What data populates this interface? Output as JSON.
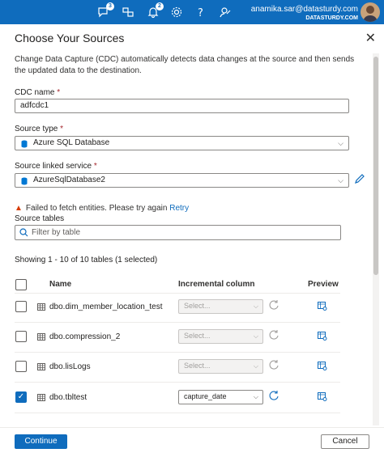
{
  "topbar": {
    "feedback_badge": "3",
    "notifications_badge": "2",
    "user_email": "anamika.sar@datasturdy.com",
    "user_org": "DATASTURDY.COM",
    "accent_color": "#0f6cbd"
  },
  "panel": {
    "title": "Choose Your Sources",
    "close": "✕",
    "description": "Change Data Capture (CDC) automatically detects data changes at the source and then sends the updated data to the destination."
  },
  "form": {
    "cdc_name_label": "CDC name",
    "cdc_name_value": "adfcdc1",
    "source_type_label": "Source type",
    "source_type_value": "Azure SQL Database",
    "linked_service_label": "Source linked service",
    "linked_service_value": "AzureSqlDatabase2",
    "required_mark": "*"
  },
  "warning": {
    "text": "Failed to fetch entities. Please try again",
    "retry": "Retry"
  },
  "source_tables": {
    "label": "Source tables",
    "filter_placeholder": "Filter by table",
    "showing": "Showing 1 - 10 of 10 tables (1 selected)"
  },
  "table": {
    "headers": {
      "name": "Name",
      "incremental": "Incremental column",
      "preview": "Preview"
    },
    "rows": [
      {
        "name": "dbo.dim_member_location_test",
        "column": "Select...",
        "checked": false
      },
      {
        "name": "dbo.compression_2",
        "column": "Select...",
        "checked": false
      },
      {
        "name": "dbo.lisLogs",
        "column": "Select...",
        "checked": false
      },
      {
        "name": "dbo.tbltest",
        "column": "capture_date",
        "checked": true
      }
    ]
  },
  "footer": {
    "continue": "Continue",
    "cancel": "Cancel"
  }
}
